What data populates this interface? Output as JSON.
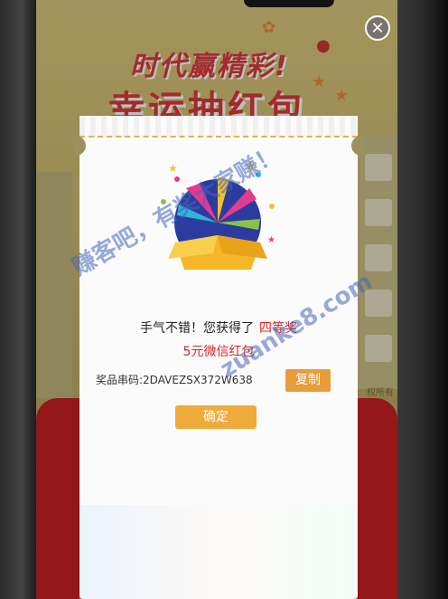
{
  "banner": {
    "line1": "时代赢精彩!",
    "line2": "幸运抽红包"
  },
  "close": {
    "icon": "close-icon",
    "glyph": "✕"
  },
  "side": {
    "text": "权所有"
  },
  "result": {
    "intro": "手气不错！您获得了",
    "level": "四等奖",
    "prize": "5元微信红包"
  },
  "code": {
    "label": "奖品串码:",
    "value": "2DAVEZSX372W638"
  },
  "buttons": {
    "copy": "复制",
    "confirm": "确定"
  },
  "watermark": {
    "text": "赚客吧，有奖大家赚！",
    "url": "zuanke8.com"
  },
  "colors": {
    "accent": "#e89d3a",
    "prize_red": "#d6252a",
    "envelope_red": "#c41e22"
  }
}
